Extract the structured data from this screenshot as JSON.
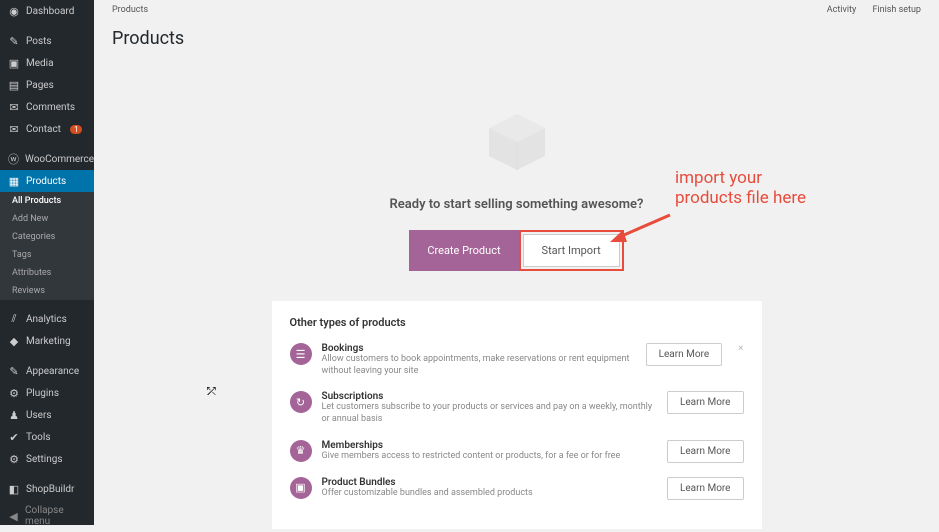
{
  "breadcrumb": "Products",
  "top_links": {
    "activity": "Activity",
    "finish": "Finish setup"
  },
  "page_title": "Products",
  "sidebar": {
    "dashboard": "Dashboard",
    "posts": "Posts",
    "media": "Media",
    "pages": "Pages",
    "comments": "Comments",
    "contact": "Contact",
    "contact_badge": "1",
    "woo": "WooCommerce",
    "products": "Products",
    "sub": {
      "all": "All Products",
      "add": "Add New",
      "cat": "Categories",
      "tags": "Tags",
      "attr": "Attributes",
      "rev": "Reviews"
    },
    "analytics": "Analytics",
    "marketing": "Marketing",
    "appearance": "Appearance",
    "plugins": "Plugins",
    "users": "Users",
    "tools": "Tools",
    "settings": "Settings",
    "shopbuildr": "ShopBuildr",
    "collapse": "Collapse menu"
  },
  "hero": {
    "headline": "Ready to start selling something awesome?",
    "create": "Create Product",
    "import": "Start Import"
  },
  "annotation": {
    "line1": "import your",
    "line2": "products file here"
  },
  "panel": {
    "title": "Other types of products",
    "learn": "Learn More",
    "items": [
      {
        "title": "Bookings",
        "desc": "Allow customers to book appointments, make reservations or rent equipment without leaving your site"
      },
      {
        "title": "Subscriptions",
        "desc": "Let customers subscribe to your products or services and pay on a weekly, monthly or annual basis"
      },
      {
        "title": "Memberships",
        "desc": "Give members access to restricted content or products, for a fee or for free"
      },
      {
        "title": "Product Bundles",
        "desc": "Offer customizable bundles and assembled products"
      }
    ]
  }
}
